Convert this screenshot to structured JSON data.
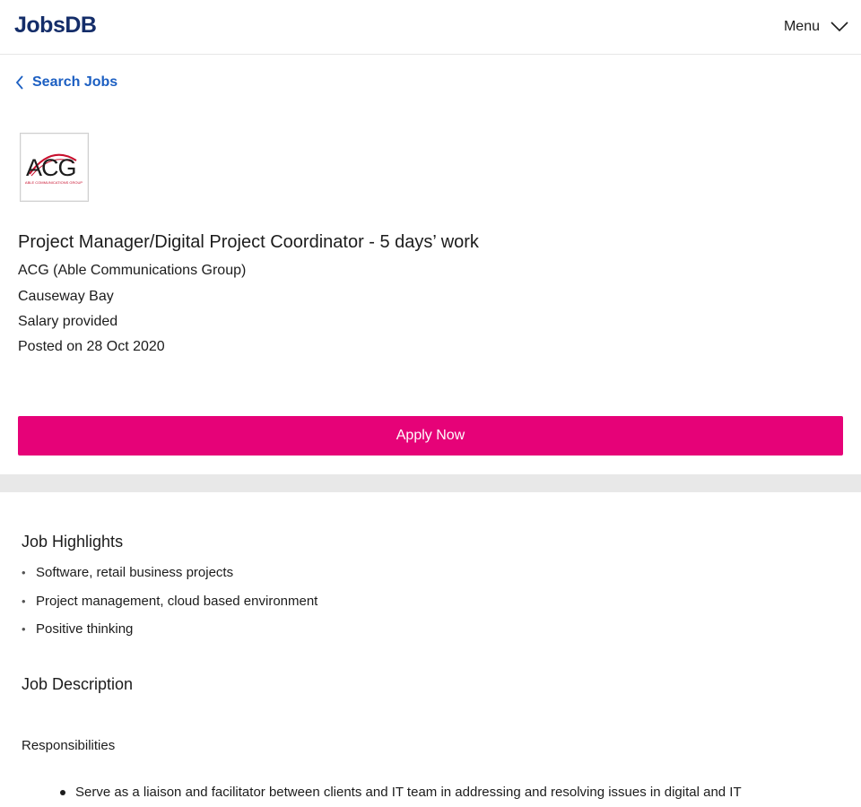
{
  "header": {
    "logo_text": "JobsDB",
    "menu_label": "Menu",
    "menu_icon": "chevron-down-icon"
  },
  "nav": {
    "back_label": "Search Jobs",
    "back_icon": "chevron-left-icon"
  },
  "job": {
    "company_logo_text": "ACG",
    "company_logo_subtext": "ABLE COMMUNICATIONS GROUP",
    "title": "Project Manager/Digital Project Coordinator - 5 days’ work",
    "company": "ACG (Able Communications Group)",
    "location": "Causeway Bay",
    "salary": "Salary provided",
    "posted": "Posted on 28 Oct 2020",
    "apply_label": "Apply Now"
  },
  "highlights": {
    "heading": "Job Highlights",
    "items": [
      "Software, retail business projects",
      "Project management, cloud based environment",
      "Positive thinking"
    ]
  },
  "description": {
    "heading": "Job Description",
    "subheading": "Responsibilities",
    "items": [
      "Serve as a liaison and facilitator between clients and IT team in addressing and resolving issues in digital and IT"
    ]
  },
  "colors": {
    "brand_navy": "#142d69",
    "link_blue": "#1c5fc2",
    "apply_pink": "#e60278",
    "divider_gray": "#e8e8e8",
    "logo_red": "#c8102e"
  }
}
